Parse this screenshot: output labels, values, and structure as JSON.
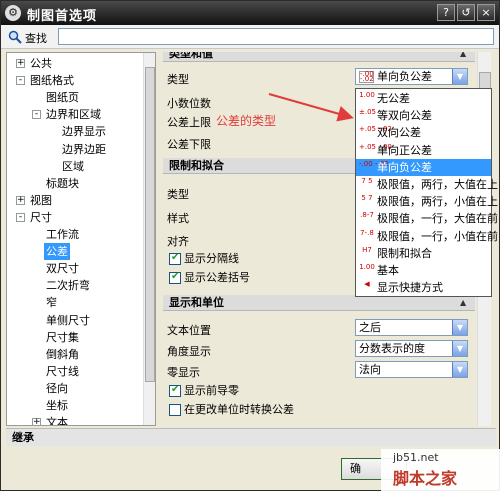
{
  "window": {
    "title": "制图首选项",
    "help_button": "?",
    "restore_button": "↺",
    "close_button": "×"
  },
  "search": {
    "label": "查找",
    "value": ""
  },
  "tree": {
    "items": [
      {
        "label": "公共",
        "toggle": "+"
      },
      {
        "label": "图纸格式",
        "toggle": "-"
      },
      {
        "label": "图纸页",
        "toggle": ""
      },
      {
        "label": "边界和区域",
        "toggle": "-"
      },
      {
        "label": "边界显示",
        "toggle": ""
      },
      {
        "label": "边界边距",
        "toggle": ""
      },
      {
        "label": "区域",
        "toggle": ""
      },
      {
        "label": "标题块",
        "toggle": ""
      },
      {
        "label": "视图",
        "toggle": "+"
      },
      {
        "label": "尺寸",
        "toggle": "-"
      },
      {
        "label": "工作流",
        "toggle": ""
      },
      {
        "label": "公差",
        "toggle": ""
      },
      {
        "label": "双尺寸",
        "toggle": ""
      },
      {
        "label": "二次折弯",
        "toggle": ""
      },
      {
        "label": "窄",
        "toggle": ""
      },
      {
        "label": "单侧尺寸",
        "toggle": ""
      },
      {
        "label": "尺寸集",
        "toggle": ""
      },
      {
        "label": "倒斜角",
        "toggle": ""
      },
      {
        "label": "尺寸线",
        "toggle": ""
      },
      {
        "label": "径向",
        "toggle": ""
      },
      {
        "label": "坐标",
        "toggle": ""
      },
      {
        "label": "文本",
        "toggle": "+"
      }
    ],
    "selected_index": 11
  },
  "sections": {
    "type_and_value": {
      "title": "类型和值",
      "type_label": "类型",
      "type_value": "单向负公差",
      "decimals_label": "小数位数",
      "upper_label": "公差上限",
      "lower_label": "公差下限"
    },
    "limits_and_fits": {
      "title": "限制和拟合",
      "type_label": "类型",
      "style_label": "样式",
      "align_label": "对齐",
      "show_separator": "显示分隔线",
      "show_bracket": "显示公差括号"
    },
    "display_and_units": {
      "title": "显示和单位",
      "text_position_label": "文本位置",
      "text_position_value": "之后",
      "angle_label": "角度显示",
      "angle_value": "分数表示的度",
      "zero_label": "零显示",
      "zero_value": "法向",
      "show_leading_zero": "显示前导零",
      "convert_on_unit_change": "在更改单位时转换公差"
    }
  },
  "annotation": "公差的类型",
  "popup": {
    "items": [
      {
        "symbol": "1.00",
        "label": "无公差"
      },
      {
        "symbol": "±.05",
        "label": "等双向公差"
      },
      {
        "symbol": "+.05 -.02",
        "label": "双向公差"
      },
      {
        "symbol": "+.05 -.00",
        "label": "单向正公差"
      },
      {
        "symbol": "-.00 -.02",
        "label": "单向负公差"
      },
      {
        "symbol": "7 5",
        "label": "极限值，两行，大值在上"
      },
      {
        "symbol": "5 7",
        "label": "极限值，两行，小值在上"
      },
      {
        "symbol": ".8-7",
        "label": "极限值，一行，大值在前"
      },
      {
        "symbol": "7-.8",
        "label": "极限值，一行，小值在前"
      },
      {
        "symbol": "H7",
        "label": "限制和拟合"
      },
      {
        "symbol": "1.00",
        "label": "基本"
      },
      {
        "symbol": "◀",
        "label": "显示快捷方式"
      }
    ],
    "selected_index": 4
  },
  "inherit": {
    "label": "继承"
  },
  "buttons": {
    "ok": "确"
  },
  "watermark": {
    "url": "jb51.net",
    "name": "脚本之家"
  },
  "colors": {
    "selection": "#3399ff",
    "annotation": "#e23b3b",
    "title_bar": "#111111"
  }
}
